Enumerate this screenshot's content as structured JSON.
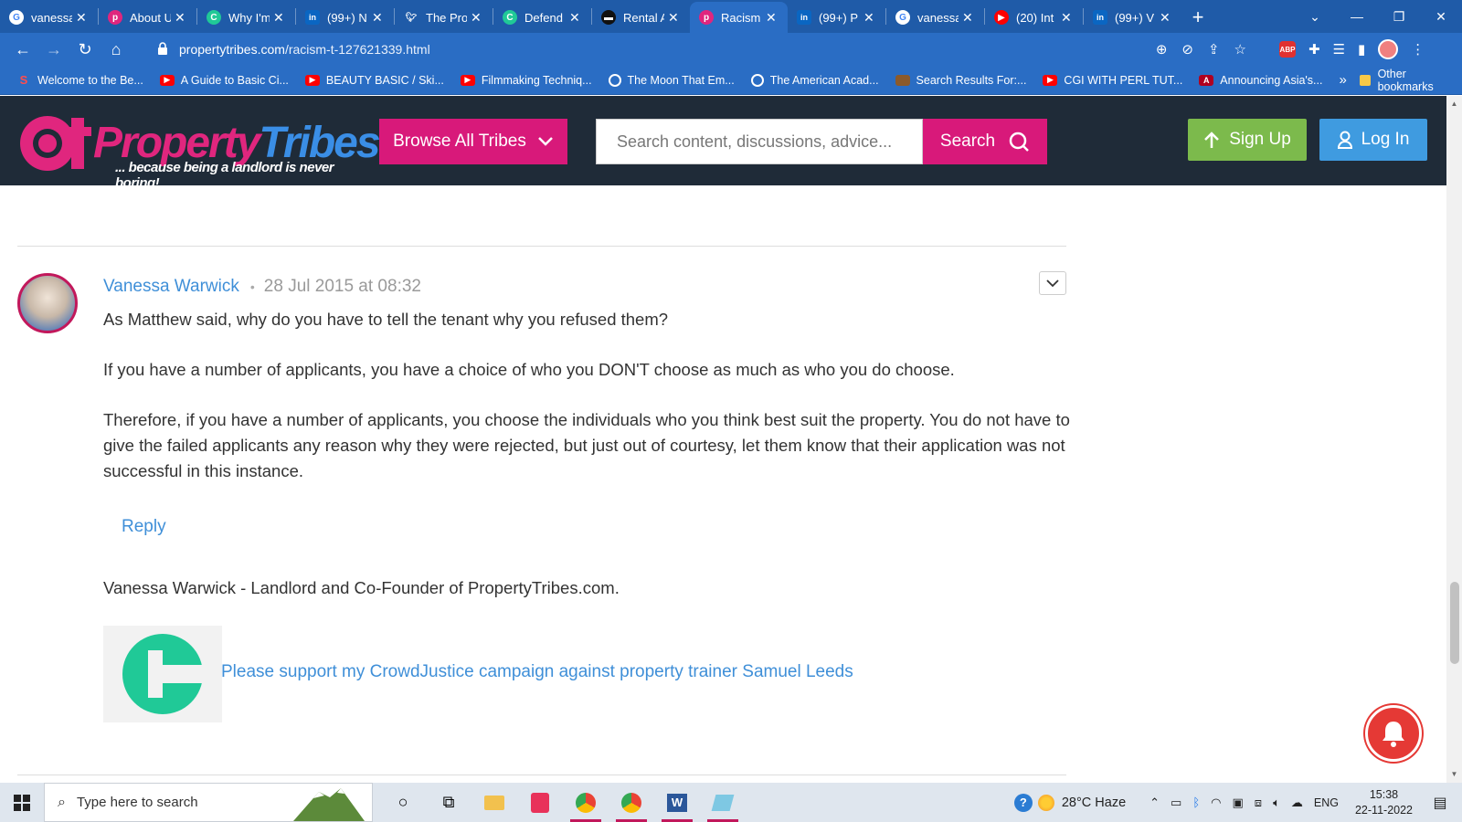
{
  "browser": {
    "tabs": [
      {
        "title": "vanessa",
        "icon": "google-icon",
        "active": false
      },
      {
        "title": "About U",
        "icon": "propertytribes-icon",
        "active": false
      },
      {
        "title": "Why I'm",
        "icon": "crowdjustice-icon",
        "active": false
      },
      {
        "title": "(99+) N",
        "icon": "linkedin-icon",
        "active": false
      },
      {
        "title": "The Pro",
        "icon": "twitter-icon",
        "active": false
      },
      {
        "title": "Defend",
        "icon": "crowdjustice-icon",
        "active": false
      },
      {
        "title": "Rental A",
        "icon": "rental-icon",
        "active": false
      },
      {
        "title": "Racism",
        "icon": "propertytribes-icon",
        "active": true
      },
      {
        "title": "(99+) P",
        "icon": "linkedin-icon",
        "active": false
      },
      {
        "title": "vanessa",
        "icon": "google-icon",
        "active": false
      },
      {
        "title": "(20) Int",
        "icon": "youtube-icon",
        "active": false
      },
      {
        "title": "(99+) V",
        "icon": "linkedin-icon",
        "active": false
      }
    ],
    "url_host": "propertytribes.com",
    "url_path": "/racism-t-127621339.html",
    "extension_badge": "3",
    "bookmarks": [
      {
        "label": "Welcome to the Be...",
        "icon": "s"
      },
      {
        "label": "A Guide to Basic Ci...",
        "icon": "yt"
      },
      {
        "label": "BEAUTY BASIC / Ski...",
        "icon": "yt"
      },
      {
        "label": "Filmmaking Techniq...",
        "icon": "yt"
      },
      {
        "label": "The Moon That Em...",
        "icon": "globe"
      },
      {
        "label": "The American Acad...",
        "icon": "globe"
      },
      {
        "label": "Search Results For:...",
        "icon": "chest"
      },
      {
        "label": "CGI WITH PERL TUT...",
        "icon": "yt"
      },
      {
        "label": "Announcing Asia's...",
        "icon": "a"
      }
    ],
    "bookmarks_more": "»",
    "other_bookmarks": "Other bookmarks"
  },
  "site": {
    "logo_text_1": "Property",
    "logo_text_2": "Tribes",
    "logo_tagline": "... because being a landlord is never boring!",
    "browse_label": "Browse All Tribes",
    "search_placeholder": "Search content, discussions, advice...",
    "search_label": "Search",
    "signup_label": "Sign Up",
    "login_label": "Log In",
    "colors": {
      "header_bg": "#1f2b38",
      "magenta": "#d8197a",
      "green": "#7cba4c",
      "blue": "#3f9be0",
      "link": "#3f8fd8"
    }
  },
  "post": {
    "author": "Vanessa Warwick",
    "separator": "•",
    "date": "28 Jul 2015 at 08:32",
    "paragraphs": [
      "As Matthew said, why do you have to tell the tenant why you refused them?",
      "If you have a number of applicants, you have a choice of who you DON'T choose as much as who you do choose.",
      "Therefore, if you have a number of applicants, you choose the individuals who you think best suit the property. You do not have to give the failed applicants any reason why they were rejected, but just out of courtesy, let them know that their application was not successful in this instance."
    ],
    "reply_label": "Reply",
    "signature": "Vanessa Warwick - Landlord and Co-Founder of PropertyTribes.com.",
    "campaign_link": "Please support my CrowdJustice campaign against property trainer Samuel Leeds"
  },
  "taskbar": {
    "search_placeholder": "Type here to search",
    "weather": "28°C  Haze",
    "language": "ENG",
    "time": "15:38",
    "date": "22-11-2022"
  }
}
